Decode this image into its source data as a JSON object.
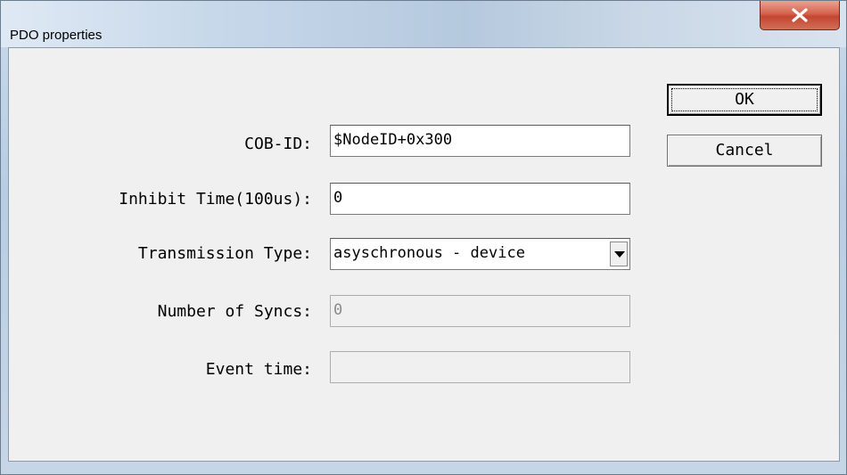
{
  "window": {
    "title": "PDO properties"
  },
  "fields": {
    "cob_id": {
      "label": "COB-ID:",
      "value": "$NodeID+0x300"
    },
    "inhibit_time": {
      "label": "Inhibit Time(100us):",
      "value": "0"
    },
    "transmission_type": {
      "label": "Transmission Type:",
      "value": "asyschronous - device"
    },
    "number_of_syncs": {
      "label": "Number of Syncs:",
      "value": "0"
    },
    "event_time": {
      "label": "Event time:",
      "value": ""
    }
  },
  "buttons": {
    "ok": "OK",
    "cancel": "Cancel"
  },
  "icons": {
    "close": "close-icon",
    "dropdown": "chevron-down-icon"
  }
}
